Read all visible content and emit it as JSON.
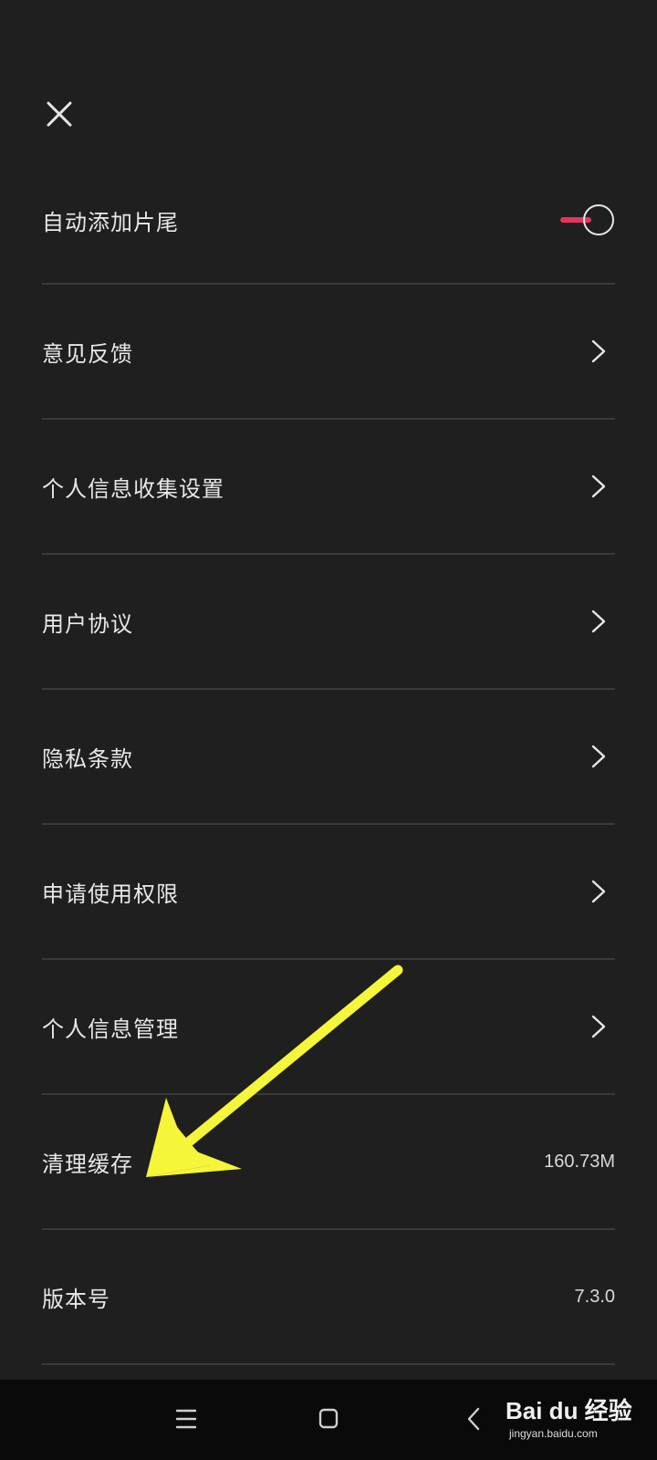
{
  "header": {
    "close_icon": "close-icon"
  },
  "settings": [
    {
      "label": "自动添加片尾",
      "type": "toggle",
      "toggle_on": true
    },
    {
      "label": "意见反馈",
      "type": "nav"
    },
    {
      "label": "个人信息收集设置",
      "type": "nav"
    },
    {
      "label": "用户协议",
      "type": "nav"
    },
    {
      "label": "隐私条款",
      "type": "nav"
    },
    {
      "label": "申请使用权限",
      "type": "nav"
    },
    {
      "label": "个人信息管理",
      "type": "nav"
    },
    {
      "label": "清理缓存",
      "type": "value",
      "value": "160.73M"
    },
    {
      "label": "版本号",
      "type": "value",
      "value": "7.3.0"
    }
  ],
  "colors": {
    "background": "#1f1f1f",
    "toggle_accent": "#e8345b",
    "annotation_arrow": "#f5f53a",
    "nav_bar": "#0a0a0a"
  },
  "nav_bar": {
    "icons": [
      "menu-icon",
      "home-square-icon",
      "back-icon"
    ]
  },
  "watermark": {
    "brand": "Bai du 经验",
    "site": "jingyan.baidu.com"
  }
}
